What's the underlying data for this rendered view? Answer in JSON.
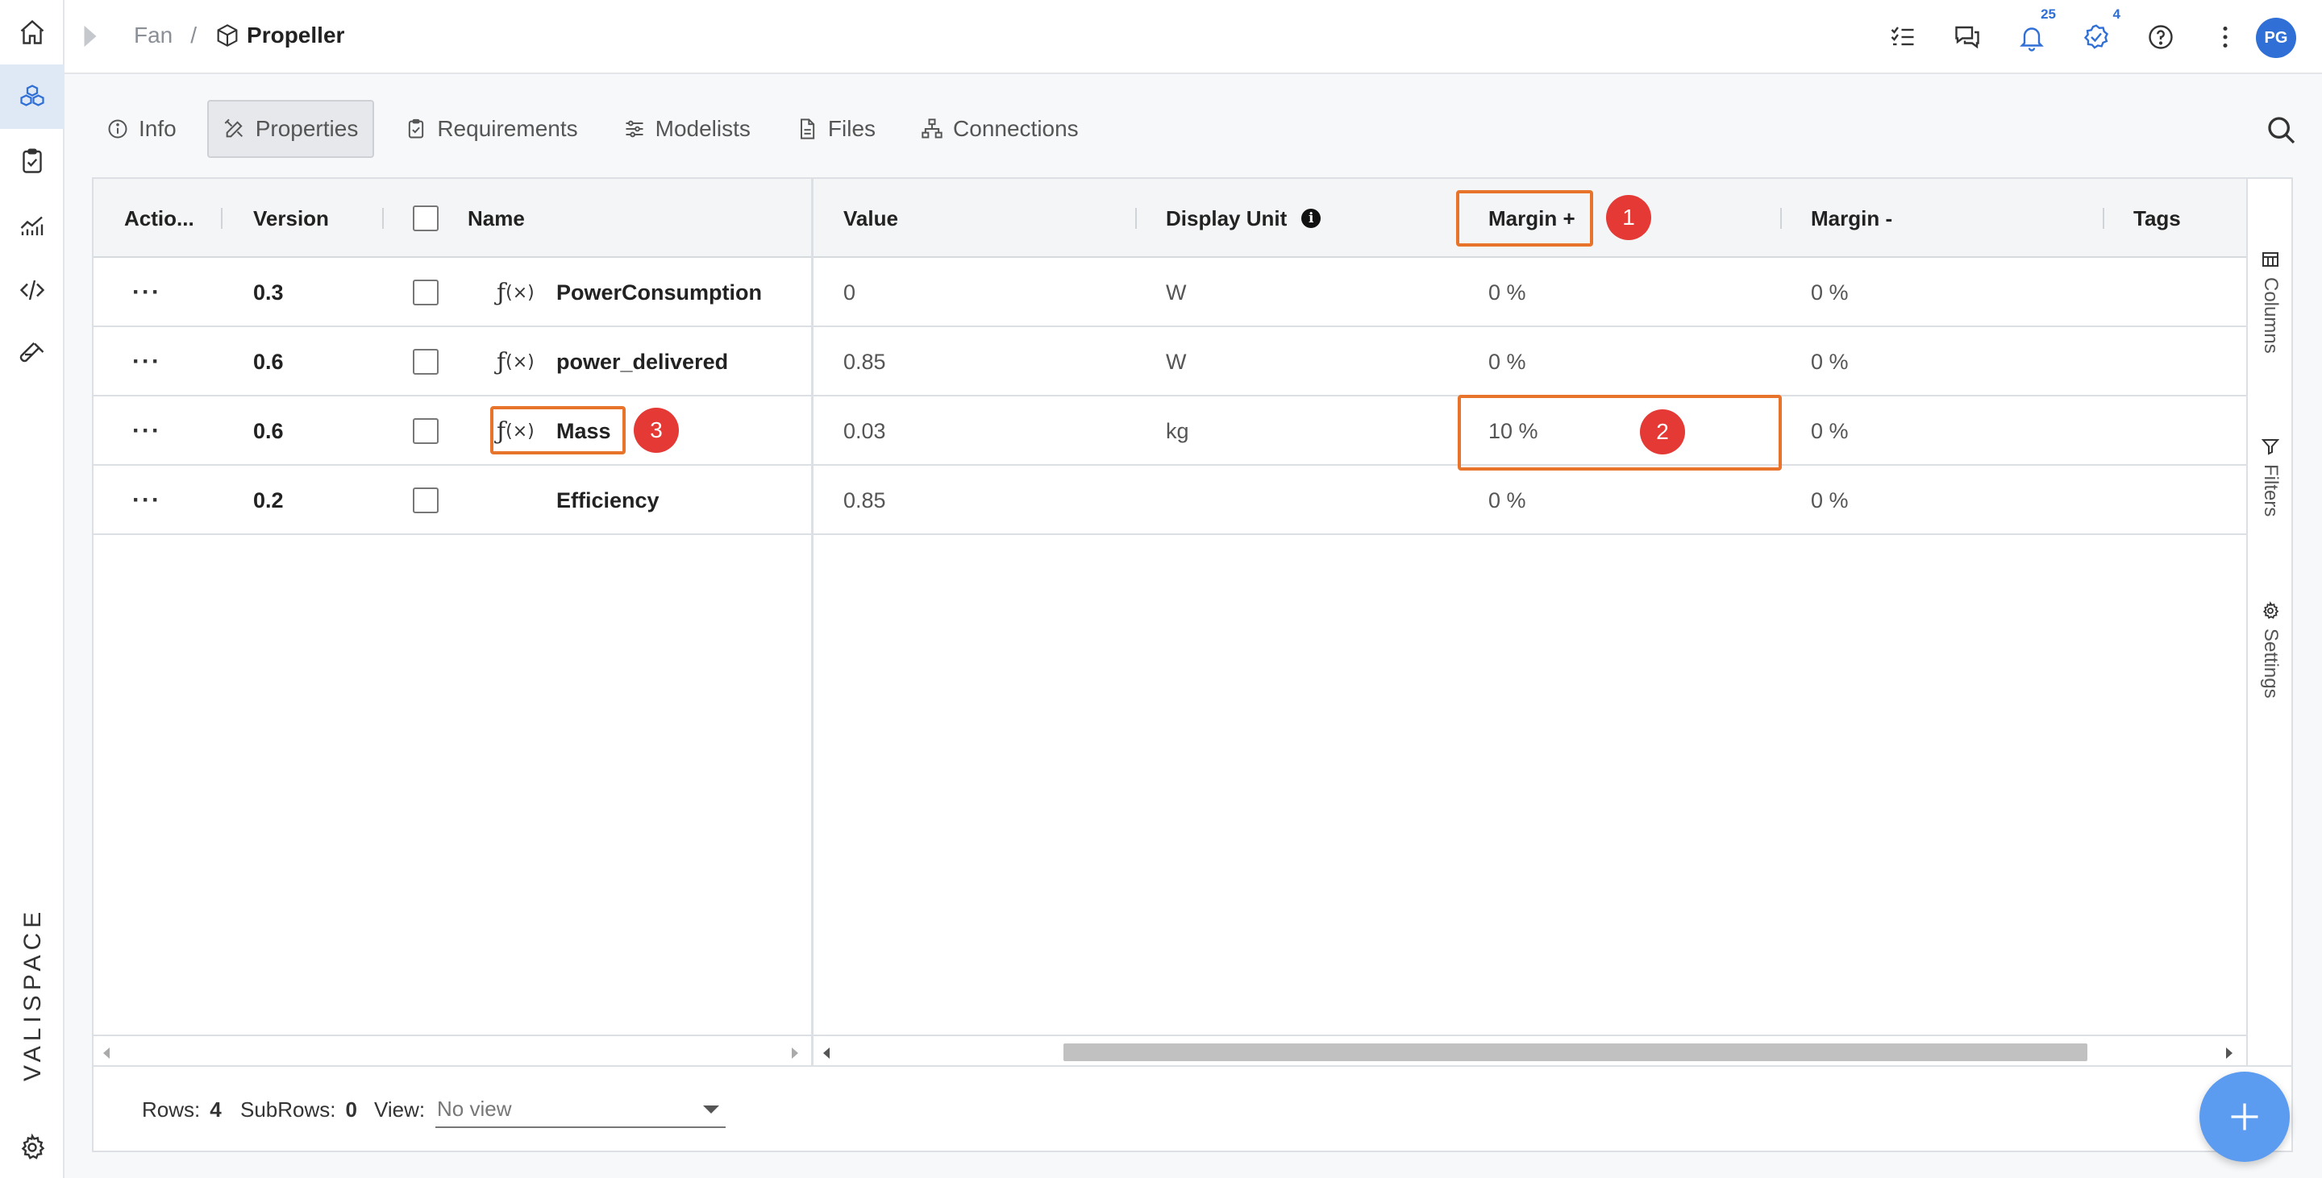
{
  "breadcrumb": {
    "parent": "Fan",
    "separator": "/",
    "current": "Propeller"
  },
  "top_actions": {
    "notifications_count": "25",
    "tasks_count": "4",
    "avatar_initials": "PG"
  },
  "brand": {
    "name": "VALISPACE"
  },
  "tabs": [
    {
      "label": "Info",
      "icon": "info-icon"
    },
    {
      "label": "Properties",
      "icon": "properties-icon",
      "active": true
    },
    {
      "label": "Requirements",
      "icon": "requirements-icon"
    },
    {
      "label": "Modelists",
      "icon": "modelists-icon"
    },
    {
      "label": "Files",
      "icon": "file-icon"
    },
    {
      "label": "Connections",
      "icon": "connections-icon"
    }
  ],
  "table": {
    "columns": [
      "Actio...",
      "Version",
      "Name",
      "Value",
      "Display Unit",
      "Margin +",
      "Margin -",
      "Tags"
    ],
    "rows": [
      {
        "actions": "···",
        "version": "0.3",
        "fx": true,
        "name": "PowerConsumption",
        "value": "0",
        "unit": "W",
        "margin_plus": "0 %",
        "margin_minus": "0 %",
        "tags": ""
      },
      {
        "actions": "···",
        "version": "0.6",
        "fx": true,
        "name": "power_delivered",
        "value": "0.85",
        "unit": "W",
        "margin_plus": "0 %",
        "margin_minus": "0 %",
        "tags": ""
      },
      {
        "actions": "···",
        "version": "0.6",
        "fx": true,
        "name": "Mass",
        "value": "0.03",
        "unit": "kg",
        "margin_plus": "10 %",
        "margin_minus": "0 %",
        "tags": ""
      },
      {
        "actions": "···",
        "version": "0.2",
        "fx": false,
        "name": "Efficiency",
        "value": "0.85",
        "unit": "",
        "margin_plus": "0 %",
        "margin_minus": "0 %",
        "tags": ""
      }
    ],
    "fx_symbol": "ƒ",
    "fx_args": "(×)"
  },
  "annotations": [
    "1",
    "2",
    "3"
  ],
  "side_panel": {
    "columns": "Columns",
    "filters": "Filters",
    "settings": "Settings"
  },
  "footer": {
    "rows_label": "Rows:",
    "rows_value": "4",
    "subrows_label": "SubRows:",
    "subrows_value": "0",
    "view_label": "View:",
    "view_placeholder": "No view"
  },
  "colors": {
    "accent": "#2f6fd6",
    "annotation_box": "#e8742b",
    "annotation_dot": "#e53935",
    "fab": "#5b9bf0"
  }
}
